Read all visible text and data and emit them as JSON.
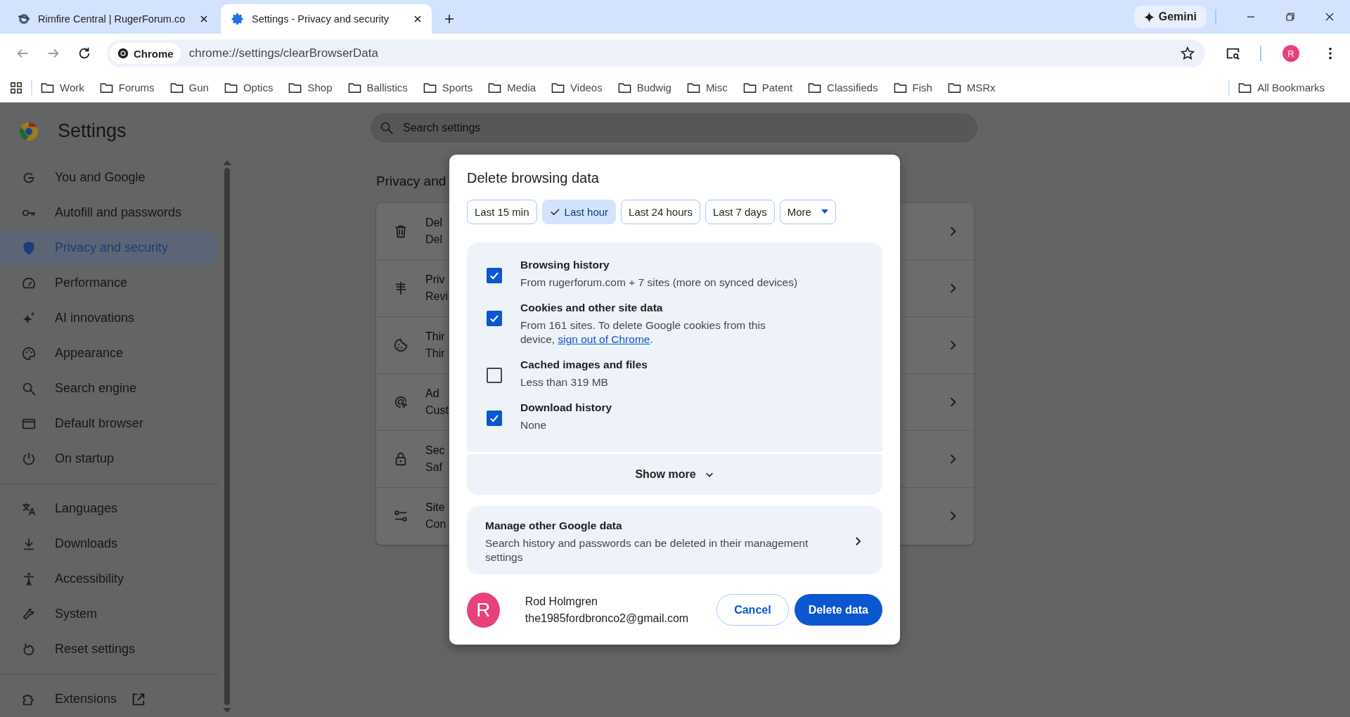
{
  "browser_tabs": [
    {
      "title": "Rimfire Central | RugerForum.co",
      "selected": false
    },
    {
      "title": "Settings - Privacy and security",
      "selected": true
    }
  ],
  "gemini": "Gemini",
  "omnibox": {
    "chip": "Chrome",
    "url": "chrome://settings/clearBrowserData"
  },
  "profile_initial": "R",
  "bookmarks": [
    "Work",
    "Forums",
    "Gun",
    "Optics",
    "Shop",
    "Ballistics",
    "Sports",
    "Media",
    "Videos",
    "Budwig",
    "Misc",
    "Patent",
    "Classifieds",
    "Fish",
    "MSRx"
  ],
  "all_bookmarks": "All Bookmarks",
  "settings": {
    "title": "Settings",
    "search_placeholder": "Search settings",
    "nav_sections": [
      [
        {
          "label": "You and Google",
          "selected": false
        },
        {
          "label": "Autofill and passwords",
          "selected": false
        },
        {
          "label": "Privacy and security",
          "selected": true
        },
        {
          "label": "Performance",
          "selected": false
        },
        {
          "label": "AI innovations",
          "selected": false
        },
        {
          "label": "Appearance",
          "selected": false
        },
        {
          "label": "Search engine",
          "selected": false
        },
        {
          "label": "Default browser",
          "selected": false
        },
        {
          "label": "On startup",
          "selected": false
        }
      ],
      [
        {
          "label": "Languages",
          "selected": false
        },
        {
          "label": "Downloads",
          "selected": false
        },
        {
          "label": "Accessibility",
          "selected": false
        },
        {
          "label": "System",
          "selected": false
        },
        {
          "label": "Reset settings",
          "selected": false
        }
      ],
      [
        {
          "label": "Extensions",
          "selected": false,
          "external": true
        }
      ]
    ],
    "section_heading": "Privacy and",
    "rows": [
      {
        "title": "Del",
        "subtitle": "Del"
      },
      {
        "title": "Priv",
        "subtitle": "Revi"
      },
      {
        "title": "Thir",
        "subtitle": "Thir"
      },
      {
        "title": "Ad",
        "subtitle": "Cust"
      },
      {
        "title": "Sec",
        "subtitle": "Saf"
      },
      {
        "title": "Site",
        "subtitle": "Con"
      }
    ]
  },
  "dialog": {
    "title": "Delete browsing data",
    "ranges": [
      {
        "label": "Last 15 min",
        "selected": false,
        "kind": "chip"
      },
      {
        "label": "Last hour",
        "selected": true,
        "kind": "chip"
      },
      {
        "label": "Last 24 hours",
        "selected": false,
        "kind": "chip"
      },
      {
        "label": "Last 7 days",
        "selected": false,
        "kind": "chip"
      },
      {
        "label": "More",
        "selected": false,
        "kind": "menu"
      }
    ],
    "items": [
      {
        "title": "Browsing history",
        "description": "From rugerforum.com + 7 sites (more on synced devices)",
        "checked": true
      },
      {
        "title": "Cookies and other site data",
        "description": "From 161 sites. To delete Google cookies from this device,",
        "link": "sign out of Chrome",
        "description_end": ".",
        "checked": true
      },
      {
        "title": "Cached images and files",
        "description": "Less than 319 MB",
        "checked": false
      },
      {
        "title": "Download history",
        "description": "None",
        "checked": true
      }
    ],
    "show_more": "Show more",
    "manage": {
      "title": "Manage other Google data",
      "description": "Search history and passwords can be deleted in their management settings"
    },
    "account": {
      "initial": "R",
      "name": "Rod Holmgren",
      "email": "the1985fordbronco2@gmail.com"
    },
    "cancel": "Cancel",
    "confirm": "Delete data"
  }
}
